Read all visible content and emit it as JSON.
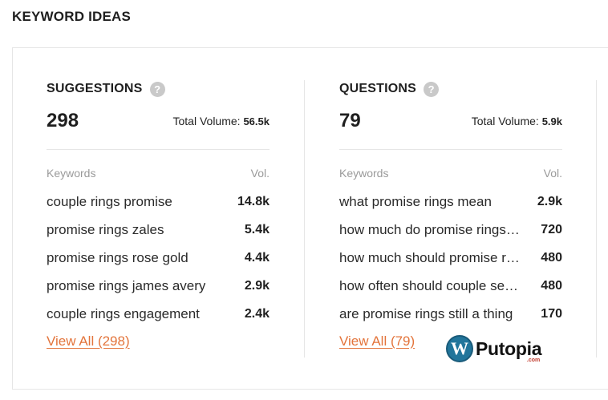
{
  "page": {
    "title": "KEYWORD IDEAS"
  },
  "suggestions": {
    "title": "SUGGESTIONS",
    "help_glyph": "?",
    "count": "298",
    "total_label": "Total Volume:",
    "total_value": "56.5k",
    "col_keywords": "Keywords",
    "col_vol": "Vol.",
    "rows": [
      {
        "keyword": "couple rings promise",
        "vol": "14.8k"
      },
      {
        "keyword": "promise rings zales",
        "vol": "5.4k"
      },
      {
        "keyword": "promise rings rose gold",
        "vol": "4.4k"
      },
      {
        "keyword": "promise rings james avery",
        "vol": "2.9k"
      },
      {
        "keyword": "couple rings engagement",
        "vol": "2.4k"
      }
    ],
    "view_all": "View All (298)"
  },
  "questions": {
    "title": "QUESTIONS",
    "help_glyph": "?",
    "count": "79",
    "total_label": "Total Volume:",
    "total_value": "5.9k",
    "col_keywords": "Keywords",
    "col_vol": "Vol.",
    "rows": [
      {
        "keyword": "what promise rings mean",
        "vol": "2.9k"
      },
      {
        "keyword": "how much do promise rings…",
        "vol": "720"
      },
      {
        "keyword": "how much should promise r…",
        "vol": "480"
      },
      {
        "keyword": "how often should couple se…",
        "vol": "480"
      },
      {
        "keyword": "are promise rings still a thing",
        "vol": "170"
      }
    ],
    "view_all": "View All (79)"
  },
  "watermark": {
    "logo_glyph": "W",
    "name": "Putopia",
    "sub": ".com"
  },
  "colors": {
    "accent": "#e3743b",
    "help_icon": "#c9c9c9",
    "border": "#e6e6e6"
  }
}
